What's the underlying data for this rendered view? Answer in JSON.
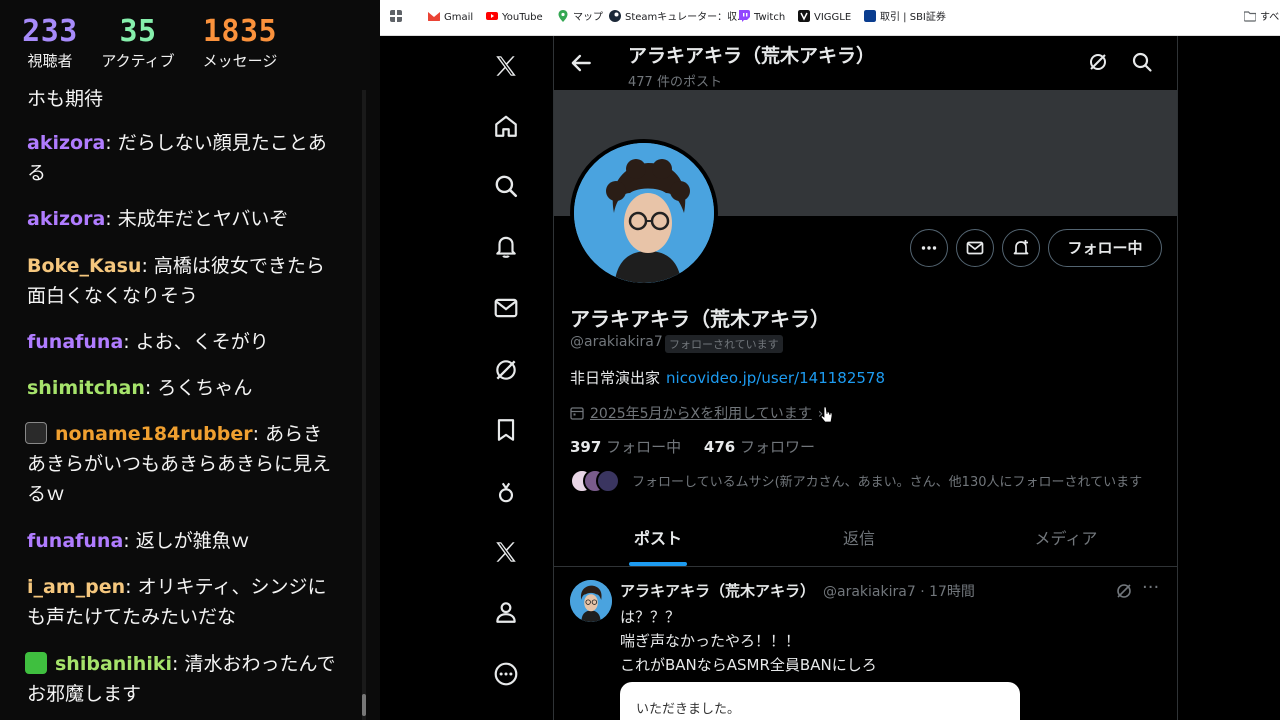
{
  "stats": {
    "viewers": {
      "value": "233",
      "label": "視聴者"
    },
    "active": {
      "value": "35",
      "label": "アクティブ"
    },
    "messages": {
      "value": "1835",
      "label": "メッセージ"
    }
  },
  "chat": {
    "top_fragment": "ホも期待",
    "messages": [
      {
        "user": "akizora",
        "color": "#b07cff",
        "text": "だらしない顔見たことある"
      },
      {
        "user": "akizora",
        "color": "#b07cff",
        "text": "未成年だとヤバいぞ"
      },
      {
        "user": "Boke_Kasu",
        "color": "#f5c77e",
        "text": "高橋は彼女できたら面白くなくなりそう"
      },
      {
        "user": "funafuna",
        "color": "#b07cff",
        "text": "よお、くそがり"
      },
      {
        "user": "shimitchan",
        "color": "#a6e36b",
        "text": "ろくちゃん"
      },
      {
        "user": "noname184rubber",
        "color": "#f0a030",
        "text": "あらきあきらがいつもあきらあきらに見えるｗ"
      },
      {
        "user": "funafuna",
        "color": "#b07cff",
        "text": "返しが雑魚ｗ"
      },
      {
        "user": "i_am_pen",
        "color": "#f5c77e",
        "text": "オリキティ、シンジにも声たけてたみたいだな"
      },
      {
        "user": "shibanihiki",
        "color": "#a6e36b",
        "text": "清水おわったんでお邪魔します"
      }
    ]
  },
  "bookmarks": [
    {
      "label": "",
      "icon": "apps-grid-icon",
      "color": "#5f6368"
    },
    {
      "label": "Gmail",
      "icon": "gmail-icon",
      "color": "#ea4335"
    },
    {
      "label": "YouTube",
      "icon": "youtube-icon",
      "color": "#ff0000"
    },
    {
      "label": "マップ",
      "icon": "maps-icon",
      "color": "#34a853"
    },
    {
      "label": "Steamキュレーター：収...",
      "icon": "steam-icon",
      "color": "#1b2838"
    },
    {
      "label": "Twitch",
      "icon": "twitch-icon",
      "color": "#9146ff"
    },
    {
      "label": "VIGGLE",
      "icon": "viggle-icon",
      "color": "#111111"
    },
    {
      "label": "取引 | SBI証券",
      "icon": "sbi-icon",
      "color": "#0a3d8f"
    },
    {
      "label": "すべ",
      "icon": "folder-icon",
      "color": "#5f6368"
    }
  ],
  "profile": {
    "top_name": "アラキアキラ（荒木アキラ）",
    "post_count": "477 件のポスト",
    "display_name": "アラキアキラ（荒木アキラ）",
    "handle": "@arakiakira7",
    "follows_you": "フォローされています",
    "bio": "非日常演出家",
    "bio_link": "nicovideo.jp/user/141182578",
    "joined": "2025年5月からXを利用しています",
    "following_count": "397",
    "following_label": "フォロー中",
    "followers_count": "476",
    "followers_label": "フォロワー",
    "followers_you_know": "フォローしているムサシ(新アカさん、あまい。さん、他130人にフォローされています",
    "follow_button": "フォロー中"
  },
  "tabs": [
    "ポスト",
    "返信",
    "メディア"
  ],
  "tweet": {
    "name": "アラキアキラ（荒木アキラ）",
    "meta": "@arakiakira7 · 17時間",
    "lines": [
      "は？？？",
      "喘ぎ声なかったやろ！！！",
      "これがBANならASMR全員BANにしろ"
    ],
    "quote_text": "いただきました。"
  },
  "colors": {
    "accent": "#1d9bf0",
    "border": "#2f3336",
    "muted": "#71767b"
  }
}
